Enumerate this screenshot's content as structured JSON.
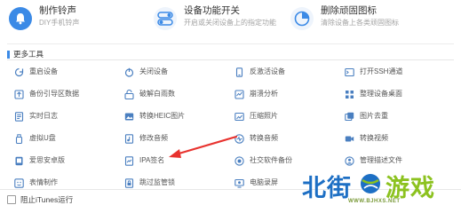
{
  "top_features": [
    {
      "title": "制作铃声",
      "desc": "DIY手机铃声",
      "icon": "bell-icon",
      "color": "#3b8ae6"
    },
    {
      "title": "设备功能开关",
      "desc": "开启或关闭设备上的指定功能",
      "icon": "toggle-switch-icon",
      "color": "#3b8ae6"
    },
    {
      "title": "删除顽固图标",
      "desc": "清除设备上各类顽固图标",
      "icon": "pie-chart-icon",
      "color": "#3b8ae6"
    }
  ],
  "section": {
    "title": "更多工具"
  },
  "tools": [
    {
      "label": "重启设备",
      "icon": "restart-device-icon"
    },
    {
      "label": "关闭设备",
      "icon": "power-icon"
    },
    {
      "label": "反激活设备",
      "icon": "deactivate-device-icon"
    },
    {
      "label": "打开SSH通道",
      "icon": "ssh-terminal-icon"
    },
    {
      "label": "备份引导区数据",
      "icon": "backup-boot-icon"
    },
    {
      "label": "破解白雨数",
      "icon": "crack-icon"
    },
    {
      "label": "崩溃分析",
      "icon": "crash-analysis-icon"
    },
    {
      "label": "整理设备桌面",
      "icon": "organize-desktop-icon"
    },
    {
      "label": "实时日志",
      "icon": "log-icon"
    },
    {
      "label": "转换HEIC图片",
      "icon": "convert-heic-icon"
    },
    {
      "label": "压缩照片",
      "icon": "compress-photo-icon"
    },
    {
      "label": "图片去重",
      "icon": "image-dedup-icon"
    },
    {
      "label": "虚拟U盘",
      "icon": "usb-drive-icon"
    },
    {
      "label": "修改音频",
      "icon": "edit-audio-icon"
    },
    {
      "label": "转换音频",
      "icon": "convert-audio-icon"
    },
    {
      "label": "转换视频",
      "icon": "convert-video-icon"
    },
    {
      "label": "爱思安卓版",
      "icon": "android-icon"
    },
    {
      "label": "IPA签名",
      "icon": "ipa-sign-icon"
    },
    {
      "label": "社交软件备份",
      "icon": "social-backup-icon"
    },
    {
      "label": "管理描述文件",
      "icon": "manage-profile-icon"
    },
    {
      "label": "表情制作",
      "icon": "emoji-icon"
    },
    {
      "label": "跳过监管锁",
      "icon": "skip-lock-icon"
    },
    {
      "label": "电脑录屏",
      "icon": "screen-record-icon"
    }
  ],
  "footer": {
    "checkbox_label": "阻止iTunes运行",
    "checked": false
  },
  "annotation": {
    "arrow_color": "#e8322e"
  },
  "watermark": {
    "part1": "北街",
    "part2": "游戏",
    "url": "WWW.BJHXS.NET",
    "color1": "#1d6fc4",
    "color2": "#8cc21f"
  },
  "colors": {
    "accent": "#3b8ae6",
    "icon": "#4a7fc0"
  }
}
